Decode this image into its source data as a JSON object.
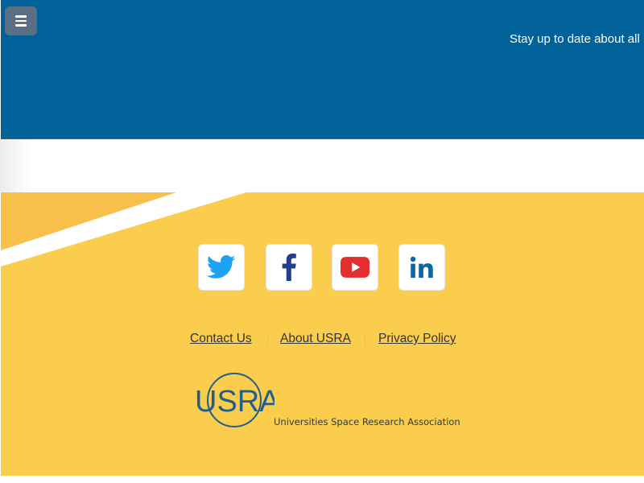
{
  "header": {
    "menu_icon": "hamburger-icon",
    "tagline": "Stay up to date about all p",
    "bg_color": "#006298"
  },
  "footer": {
    "bg_color": "#fbcd4d",
    "social": [
      {
        "name": "Twitter",
        "icon": "twitter-icon",
        "color": "#1da1f2"
      },
      {
        "name": "Facebook",
        "icon": "facebook-icon",
        "color": "#243e8f"
      },
      {
        "name": "YouTube",
        "icon": "youtube-icon",
        "color": "#e22e2e"
      },
      {
        "name": "LinkedIn",
        "icon": "linkedin-icon",
        "color": "#0a66a5"
      }
    ],
    "links": {
      "contact": "Contact Us",
      "about": "About USRA",
      "privacy": "Privacy Policy"
    },
    "logo": {
      "wordmark": "USRA",
      "tagline": "Universities Space Research Association",
      "color": "#1f5e8f"
    }
  }
}
